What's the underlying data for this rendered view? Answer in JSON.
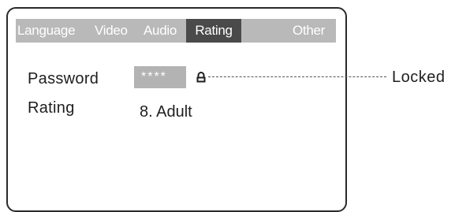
{
  "tabs": [
    {
      "label": "Language"
    },
    {
      "label": "Video"
    },
    {
      "label": "Audio"
    },
    {
      "label": "Rating",
      "active": true
    },
    {
      "label": "Other"
    }
  ],
  "settings": {
    "password_label": "Password",
    "password_value": "****",
    "rating_label": "Rating",
    "rating_value": "8. Adult"
  },
  "callout": {
    "label": "Locked",
    "icon": "lock-icon"
  },
  "colors": {
    "tabbar_bg": "#b9b9b9",
    "tab_active_bg": "#4a4a4a",
    "field_bg": "#b3b3b3",
    "frame": "#2a2a2a"
  }
}
